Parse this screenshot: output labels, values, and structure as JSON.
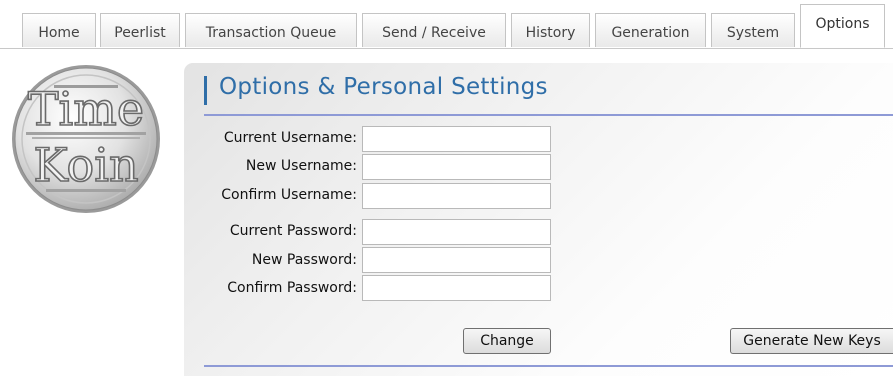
{
  "tabs": [
    {
      "label": "Home"
    },
    {
      "label": "Peerlist"
    },
    {
      "label": "Transaction Queue"
    },
    {
      "label": "Send / Receive"
    },
    {
      "label": "History"
    },
    {
      "label": "Generation"
    },
    {
      "label": "System"
    },
    {
      "label": "Options",
      "active": true
    }
  ],
  "logo": {
    "line1": "Time",
    "line2": "Koin"
  },
  "main": {
    "title": "Options & Personal Settings",
    "username": {
      "current_label": "Current Username:",
      "new_label": "New Username:",
      "confirm_label": "Confirm Username:",
      "current_value": "",
      "new_value": "",
      "confirm_value": ""
    },
    "password": {
      "current_label": "Current Password:",
      "new_label": "New Password:",
      "confirm_label": "Confirm Password:",
      "current_value": "",
      "new_value": "",
      "confirm_value": ""
    },
    "change_button": "Change",
    "generate_keys_button": "Generate New Keys"
  },
  "colors": {
    "accent": "#2f6ea8",
    "rule": "#8e9ad6"
  }
}
